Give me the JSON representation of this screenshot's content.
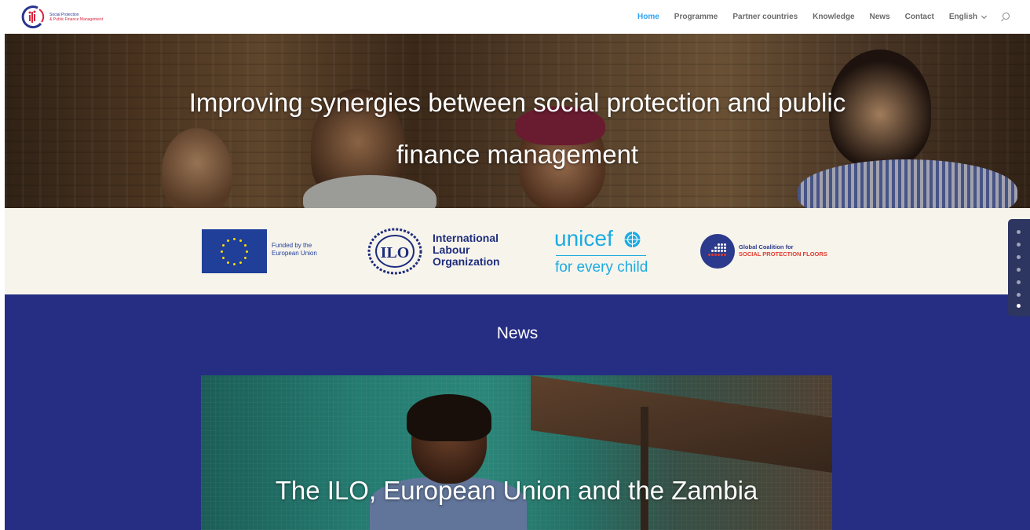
{
  "header": {
    "logo": {
      "line1": "Social Protection",
      "line2": "& Public Finance Management"
    },
    "nav": [
      {
        "label": "Home",
        "active": true
      },
      {
        "label": "Programme",
        "active": false
      },
      {
        "label": "Partner countries",
        "active": false
      },
      {
        "label": "Knowledge",
        "active": false
      },
      {
        "label": "News",
        "active": false
      },
      {
        "label": "Contact",
        "active": false
      }
    ],
    "language": "English",
    "search_icon": "search-icon"
  },
  "hero": {
    "title": "Improving synergies between social protection and public finance management"
  },
  "partners": {
    "eu": {
      "line1": "Funded by the",
      "line2": "European Union"
    },
    "ilo": {
      "emblem": "ILO",
      "line1": "International",
      "line2": "Labour",
      "line3": "Organization"
    },
    "unicef": {
      "name": "unicef",
      "tagline": "for every child"
    },
    "global_coalition": {
      "line1": "Global Coalition for",
      "line2": "SOCIAL PROTECTION FLOORS"
    }
  },
  "news": {
    "heading": "News",
    "card_title": "The ILO, European Union and the Zambia"
  },
  "dot_nav": {
    "count": 7,
    "active_index": 6
  },
  "colors": {
    "nav_active": "#2ea3f2",
    "news_bg": "#262e83",
    "partners_bg": "#f7f4ec",
    "unicef_blue": "#1cabe2",
    "eu_blue": "#1f3f99"
  }
}
